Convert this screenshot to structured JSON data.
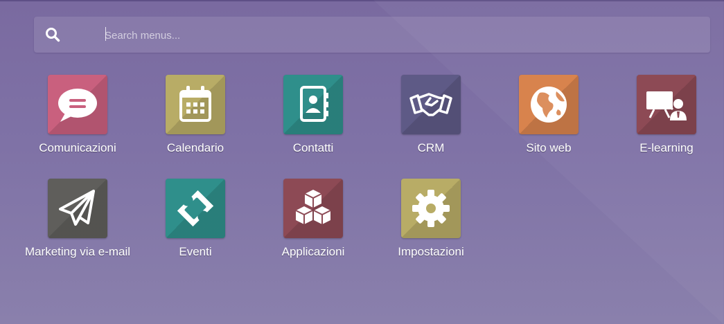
{
  "search": {
    "placeholder": "Search menus..."
  },
  "apps": [
    {
      "label": "Comunicazioni",
      "icon": "chat-bubble-icon",
      "color": "#c9607e"
    },
    {
      "label": "Calendario",
      "icon": "calendar-icon",
      "color": "#b8ac66"
    },
    {
      "label": "Contatti",
      "icon": "address-book-icon",
      "color": "#2f8f8b"
    },
    {
      "label": "CRM",
      "icon": "handshake-icon",
      "color": "#5e5a86"
    },
    {
      "label": "Sito web",
      "icon": "globe-icon",
      "color": "#d8834d"
    },
    {
      "label": "E-learning",
      "icon": "presentation-icon",
      "color": "#8d4a55"
    },
    {
      "label": "Marketing via e-mail",
      "icon": "paper-plane-icon",
      "color": "#5f5e5b"
    },
    {
      "label": "Eventi",
      "icon": "ticket-icon",
      "color": "#2f8f8b"
    },
    {
      "label": "Applicazioni",
      "icon": "cubes-icon",
      "color": "#8d4a55"
    },
    {
      "label": "Impostazioni",
      "icon": "gear-icon",
      "color": "#b8ac66"
    }
  ]
}
